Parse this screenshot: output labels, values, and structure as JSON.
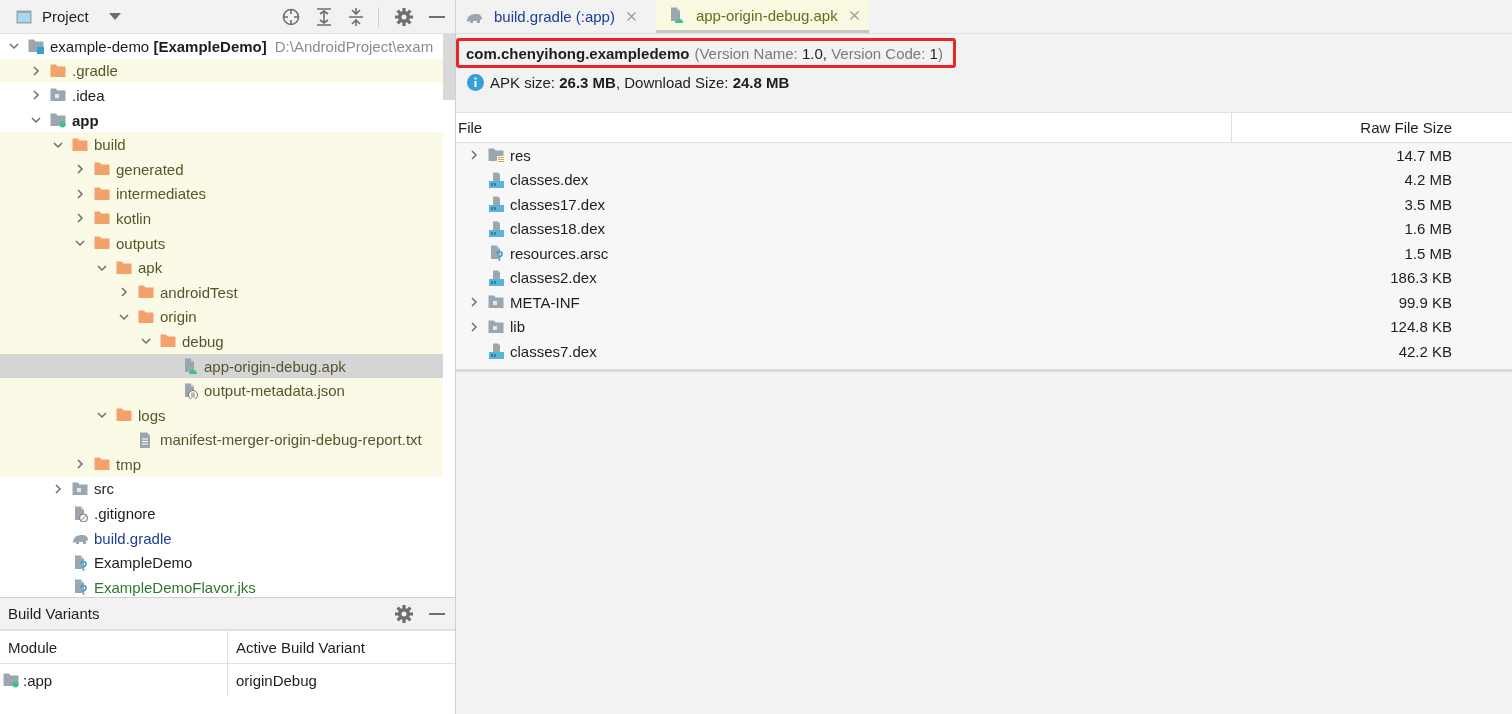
{
  "project_panel": {
    "title": "Project",
    "tree": [
      {
        "label": "example-demo **[ExampleDemo]**",
        "path": "D:\\AndroidProject\\exam",
        "kind": "project",
        "expanded": true,
        "children": [
          {
            "label": ".gradle",
            "kind": "folder",
            "excluded": true,
            "expanded": false
          },
          {
            "label": ".idea",
            "kind": "folder",
            "excluded": false,
            "expanded": false
          },
          {
            "label": "app",
            "kind": "module",
            "excluded": false,
            "expanded": true,
            "children": [
              {
                "label": "build",
                "kind": "folder",
                "excluded": true,
                "expanded": true,
                "children": [
                  {
                    "label": "generated",
                    "kind": "folder",
                    "excluded": true,
                    "expanded": false
                  },
                  {
                    "label": "intermediates",
                    "kind": "folder",
                    "excluded": true,
                    "expanded": false
                  },
                  {
                    "label": "kotlin",
                    "kind": "folder",
                    "excluded": true,
                    "expanded": false
                  },
                  {
                    "label": "outputs",
                    "kind": "folder",
                    "excluded": true,
                    "expanded": true,
                    "children": [
                      {
                        "label": "apk",
                        "kind": "folder",
                        "excluded": true,
                        "expanded": true,
                        "children": [
                          {
                            "label": "androidTest",
                            "kind": "folder",
                            "excluded": true,
                            "expanded": false
                          },
                          {
                            "label": "origin",
                            "kind": "folder",
                            "excluded": true,
                            "expanded": true,
                            "children": [
                              {
                                "label": "debug",
                                "kind": "folder",
                                "excluded": true,
                                "expanded": true,
                                "children": [
                                  {
                                    "label": "app-origin-debug.apk",
                                    "kind": "apk",
                                    "excluded": true,
                                    "selected": true
                                  },
                                  {
                                    "label": "output-metadata.json",
                                    "kind": "json",
                                    "excluded": true,
                                    "selected": false
                                  }
                                ]
                              }
                            ]
                          }
                        ]
                      },
                      {
                        "label": "logs",
                        "kind": "folder",
                        "excluded": true,
                        "expanded": true,
                        "children": [
                          {
                            "label": "manifest-merger-origin-debug-report.txt",
                            "kind": "text",
                            "excluded": true,
                            "selected": false
                          }
                        ]
                      }
                    ]
                  },
                  {
                    "label": "tmp",
                    "kind": "folder",
                    "excluded": true,
                    "expanded": false
                  }
                ]
              },
              {
                "label": "src",
                "kind": "folder",
                "excluded": false,
                "expanded": false
              },
              {
                "label": ".gitignore",
                "kind": "gitignore",
                "excluded": false,
                "selected": false
              },
              {
                "label": "build.gradle",
                "kind": "gradle",
                "excluded": false,
                "selected": false,
                "color": "#1d3e9b"
              },
              {
                "label": "ExampleDemo",
                "kind": "unknown",
                "excluded": false,
                "selected": false
              },
              {
                "label": "ExampleDemoFlavor.jks",
                "kind": "unknown",
                "excluded": false,
                "selected": false,
                "color": "#2d7a2d"
              }
            ]
          }
        ]
      }
    ]
  },
  "build_variants": {
    "title": "Build Variants",
    "columns": [
      "Module",
      "Active Build Variant"
    ],
    "rows": [
      {
        "module": ":app",
        "variant": "originDebug"
      }
    ]
  },
  "editor": {
    "tabs": [
      {
        "label": "build.gradle (:app)",
        "kind": "gradle",
        "selected": false
      },
      {
        "label": "app-origin-debug.apk",
        "kind": "apk",
        "selected": true
      }
    ],
    "package": {
      "name": "com.chenyihong.exampledemo",
      "details": [
        {
          "text": "(Version Name: ",
          "kind": "label"
        },
        {
          "text": "1.0",
          "kind": "value"
        },
        {
          "text": ", ",
          "kind": "value"
        },
        {
          "text": "Version Code: ",
          "kind": "label"
        },
        {
          "text": "1",
          "kind": "value"
        },
        {
          "text": ")",
          "kind": "label"
        }
      ]
    },
    "size_info": "APK size: **26.3 MB**, Download Size: **24.8 MB**",
    "table": {
      "columns": [
        "File",
        "Raw File Size"
      ],
      "rows": [
        {
          "name": "res",
          "kind": "res",
          "expanded": false,
          "size": "14.7 MB"
        },
        {
          "name": "classes.dex",
          "kind": "dex",
          "size": "4.2 MB"
        },
        {
          "name": "classes17.dex",
          "kind": "dex",
          "size": "3.5 MB"
        },
        {
          "name": "classes18.dex",
          "kind": "dex",
          "size": "1.6 MB"
        },
        {
          "name": "resources.arsc",
          "kind": "unknown",
          "size": "1.5 MB"
        },
        {
          "name": "classes2.dex",
          "kind": "dex",
          "size": "186.3 KB"
        },
        {
          "name": "META-INF",
          "kind": "folder",
          "expanded": false,
          "size": "99.9 KB"
        },
        {
          "name": "lib",
          "kind": "folder",
          "expanded": false,
          "size": "124.8 KB"
        },
        {
          "name": "classes7.dex",
          "kind": "dex",
          "size": "42.2 KB"
        }
      ]
    }
  }
}
